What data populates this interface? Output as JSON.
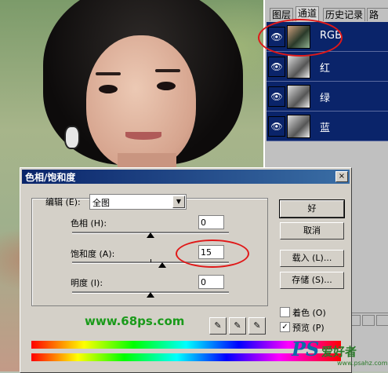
{
  "layers_panel": {
    "tabs": [
      "图层",
      "通道",
      "历史记录",
      "路径"
    ],
    "channels": [
      {
        "name": "RGB",
        "visible": true
      },
      {
        "name": "红",
        "visible": true
      },
      {
        "name": "绿",
        "visible": true
      },
      {
        "name": "蓝",
        "visible": true
      }
    ]
  },
  "dialog": {
    "title": "色相/饱和度",
    "close_glyph": "×",
    "edit_label": "编辑 (E):",
    "edit_value": "全图",
    "hue_label": "色相 (H):",
    "hue_value": "0",
    "saturation_label": "饱和度 (A):",
    "saturation_value": "15",
    "lightness_label": "明度 (I):",
    "lightness_value": "0",
    "ok_label": "好",
    "cancel_label": "取消",
    "load_label": "载入 (L)...",
    "save_label": "存储 (S)...",
    "colorize_label": "着色 (O)",
    "colorize_checked": false,
    "preview_label": "预览 (P)",
    "preview_checked": true
  },
  "watermark": {
    "site": "www.68ps.com",
    "brand": "PS",
    "brand_suffix": "爱好者",
    "brand_url": "www.psahz.com"
  },
  "colors": {
    "highlight_ring": "#e01818",
    "channel_row_bg": "#0a246a",
    "dialog_titlebar": "#0a246a"
  }
}
